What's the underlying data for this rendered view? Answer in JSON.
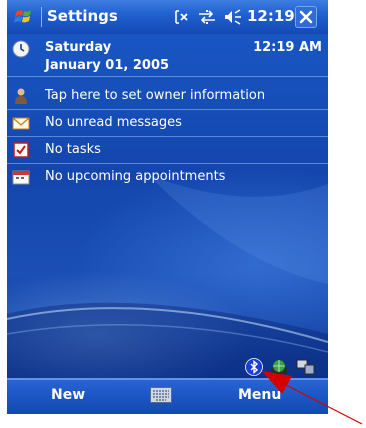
{
  "title_bar": {
    "title": "Settings",
    "clock": "12:19",
    "icons": [
      "start-flag-icon",
      "connectivity-off-icon",
      "sync-arrows-icon",
      "volume-icon",
      "close-icon"
    ],
    "accent": "#1f5fce"
  },
  "today": {
    "date_row": {
      "day": "Saturday",
      "date": "January 01, 2005",
      "time": "12:19 AM",
      "icon": "clock-icon"
    },
    "items": [
      {
        "label": "Tap here to set owner information",
        "icon": "owner-icon"
      },
      {
        "label": "No unread messages",
        "icon": "envelope-icon"
      },
      {
        "label": "No tasks",
        "icon": "tasks-checkbox-icon"
      },
      {
        "label": "No upcoming appointments",
        "icon": "calendar-icon"
      }
    ],
    "tray_icons": [
      "bluetooth-icon",
      "network-globe-icon",
      "devices-icon"
    ]
  },
  "menu_bar": {
    "left": "New",
    "right": "Menu",
    "center_icon": "keyboard-icon"
  },
  "annotation": {
    "color": "#d40000",
    "icon": "red-arrow-pointer"
  }
}
